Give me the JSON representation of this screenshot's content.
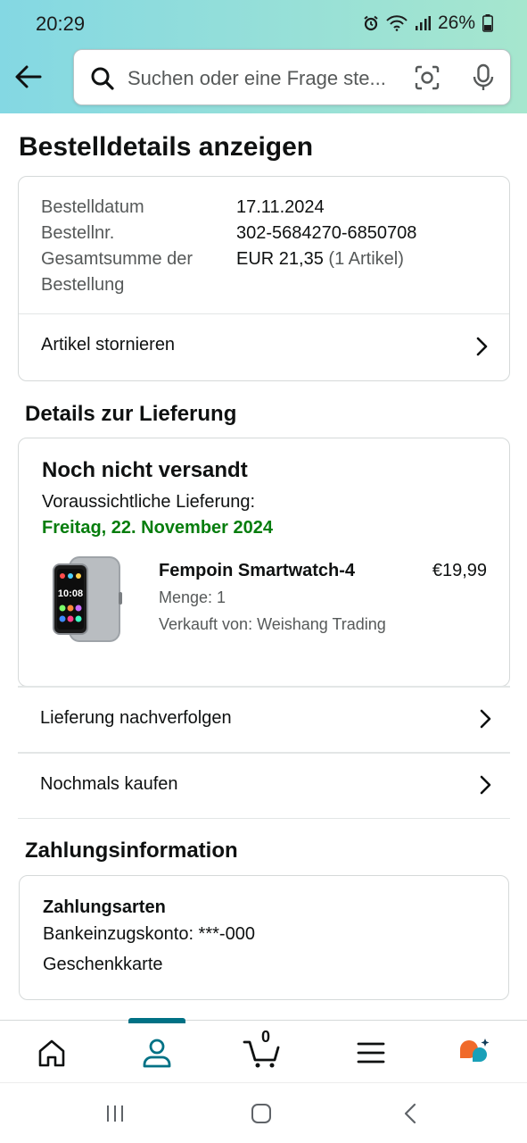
{
  "status_bar": {
    "time": "20:29",
    "battery": "26%"
  },
  "search": {
    "placeholder": "Suchen oder eine Frage ste..."
  },
  "page": {
    "title": "Bestelldetails anzeigen"
  },
  "order_summary": {
    "date_label": "Bestelldatum",
    "date_value": "17.11.2024",
    "number_label": "Bestellnr.",
    "number_value": "302-5684270-6850708",
    "total_label_line1": "Gesamtsumme der",
    "total_label_line2": "Bestellung",
    "total_value": "EUR 21,35",
    "total_items": "(1 Artikel)",
    "cancel_label": "Artikel stornieren"
  },
  "delivery": {
    "section_title": "Details zur Lieferung",
    "status": "Noch nicht versandt",
    "expected_label": "Voraussichtliche Lieferung:",
    "expected_date": "Freitag, 22. November 2024",
    "product": {
      "name": "Fempoin Smartwatch-4",
      "price": "€19,99",
      "quantity": "Menge: 1",
      "seller": "Verkauft von: Weishang Trading",
      "watch_time": "10:08"
    },
    "track_label": "Lieferung nachverfolgen",
    "buy_again_label": "Nochmals kaufen"
  },
  "payment": {
    "section_title": "Zahlungsinformation",
    "methods_title": "Zahlungsarten",
    "method_1": "Bankeinzugskonto: ***-000",
    "method_2": "Geschenkkarte"
  },
  "bottom_nav": {
    "cart_count": "0",
    "active_tab": "account"
  },
  "colors": {
    "accent": "#007185",
    "delivery_green": "#067d0d",
    "header_start": "#84d8e3",
    "header_end": "#a6e6ce"
  }
}
